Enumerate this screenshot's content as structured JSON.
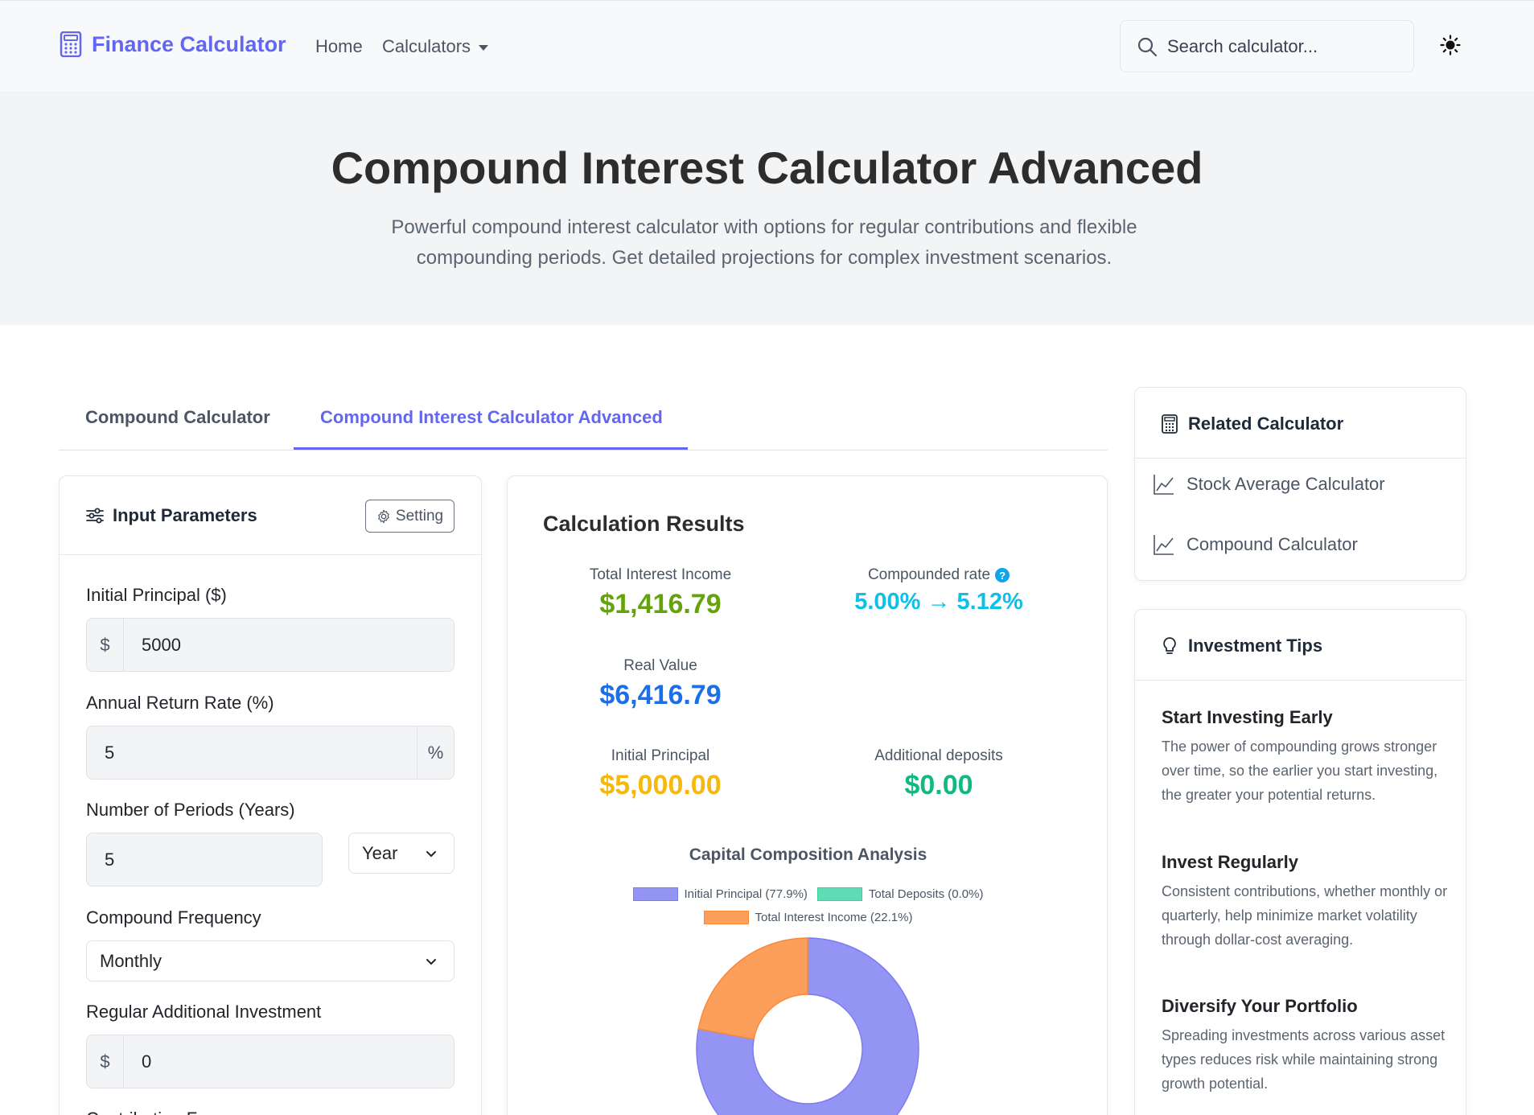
{
  "nav": {
    "brand": "Finance Calculator",
    "home": "Home",
    "calculators": "Calculators",
    "search_placeholder": "Search calculator..."
  },
  "hero": {
    "title": "Compound Interest Calculator Advanced",
    "subtitle": "Powerful compound interest calculator with options for regular contributions and flexible compounding periods. Get detailed projections for complex investment scenarios."
  },
  "tabs": [
    "Compound Calculator",
    "Compound Interest Calculator Advanced"
  ],
  "inputs": {
    "title": "Input Parameters",
    "setting": "Setting",
    "principal_label": "Initial Principal ($)",
    "principal_prefix": "$",
    "principal_value": "5000",
    "rate_label": "Annual Return Rate (%)",
    "rate_value": "5",
    "rate_suffix": "%",
    "periods_label": "Number of Periods (Years)",
    "periods_value": "5",
    "periods_unit": "Year",
    "frequency_label": "Compound Frequency",
    "frequency_value": "Monthly",
    "additional_label": "Regular Additional Investment",
    "additional_prefix": "$",
    "additional_value": "0",
    "next_label": "Contribution F"
  },
  "results": {
    "title": "Calculation Results",
    "interest_label": "Total Interest Income",
    "interest_value": "$1,416.79",
    "rate_label": "Compounded rate",
    "rate_value": "5.00% → 5.12%",
    "real_label": "Real Value",
    "real_value": "$6,416.79",
    "principal_label": "Initial Principal",
    "principal_value": "$5,000.00",
    "deposits_label": "Additional deposits",
    "deposits_value": "$0.00",
    "colors": {
      "interest": "#65a30d",
      "rate": "#0ea5e9",
      "real": "#1d6fe8",
      "principal": "#f5b80b",
      "deposits": "#10b981"
    }
  },
  "chart_data": {
    "type": "pie",
    "title": "Capital Composition Analysis",
    "donut": true,
    "categories": [
      "Initial Principal (77.9%)",
      "Total Deposits (0.0%)",
      "Total Interest Income (22.1%)"
    ],
    "values": [
      77.9,
      0.0,
      22.1
    ],
    "colors": [
      "#9494f5",
      "#5fdcb3",
      "#fb9f5a"
    ],
    "legend_position": "top"
  },
  "related": {
    "title": "Related Calculator",
    "items": [
      "Stock Average Calculator",
      "Compound Calculator"
    ]
  },
  "tips": {
    "title": "Investment Tips",
    "items": [
      {
        "title": "Start Investing Early",
        "body": "The power of compounding grows stronger over time, so the earlier you start investing, the greater your potential returns."
      },
      {
        "title": "Invest Regularly",
        "body": "Consistent contributions, whether monthly or quarterly, help minimize market volatility through dollar-cost averaging."
      },
      {
        "title": "Diversify Your Portfolio",
        "body": "Spreading investments across various asset types reduces risk while maintaining strong growth potential."
      }
    ]
  }
}
